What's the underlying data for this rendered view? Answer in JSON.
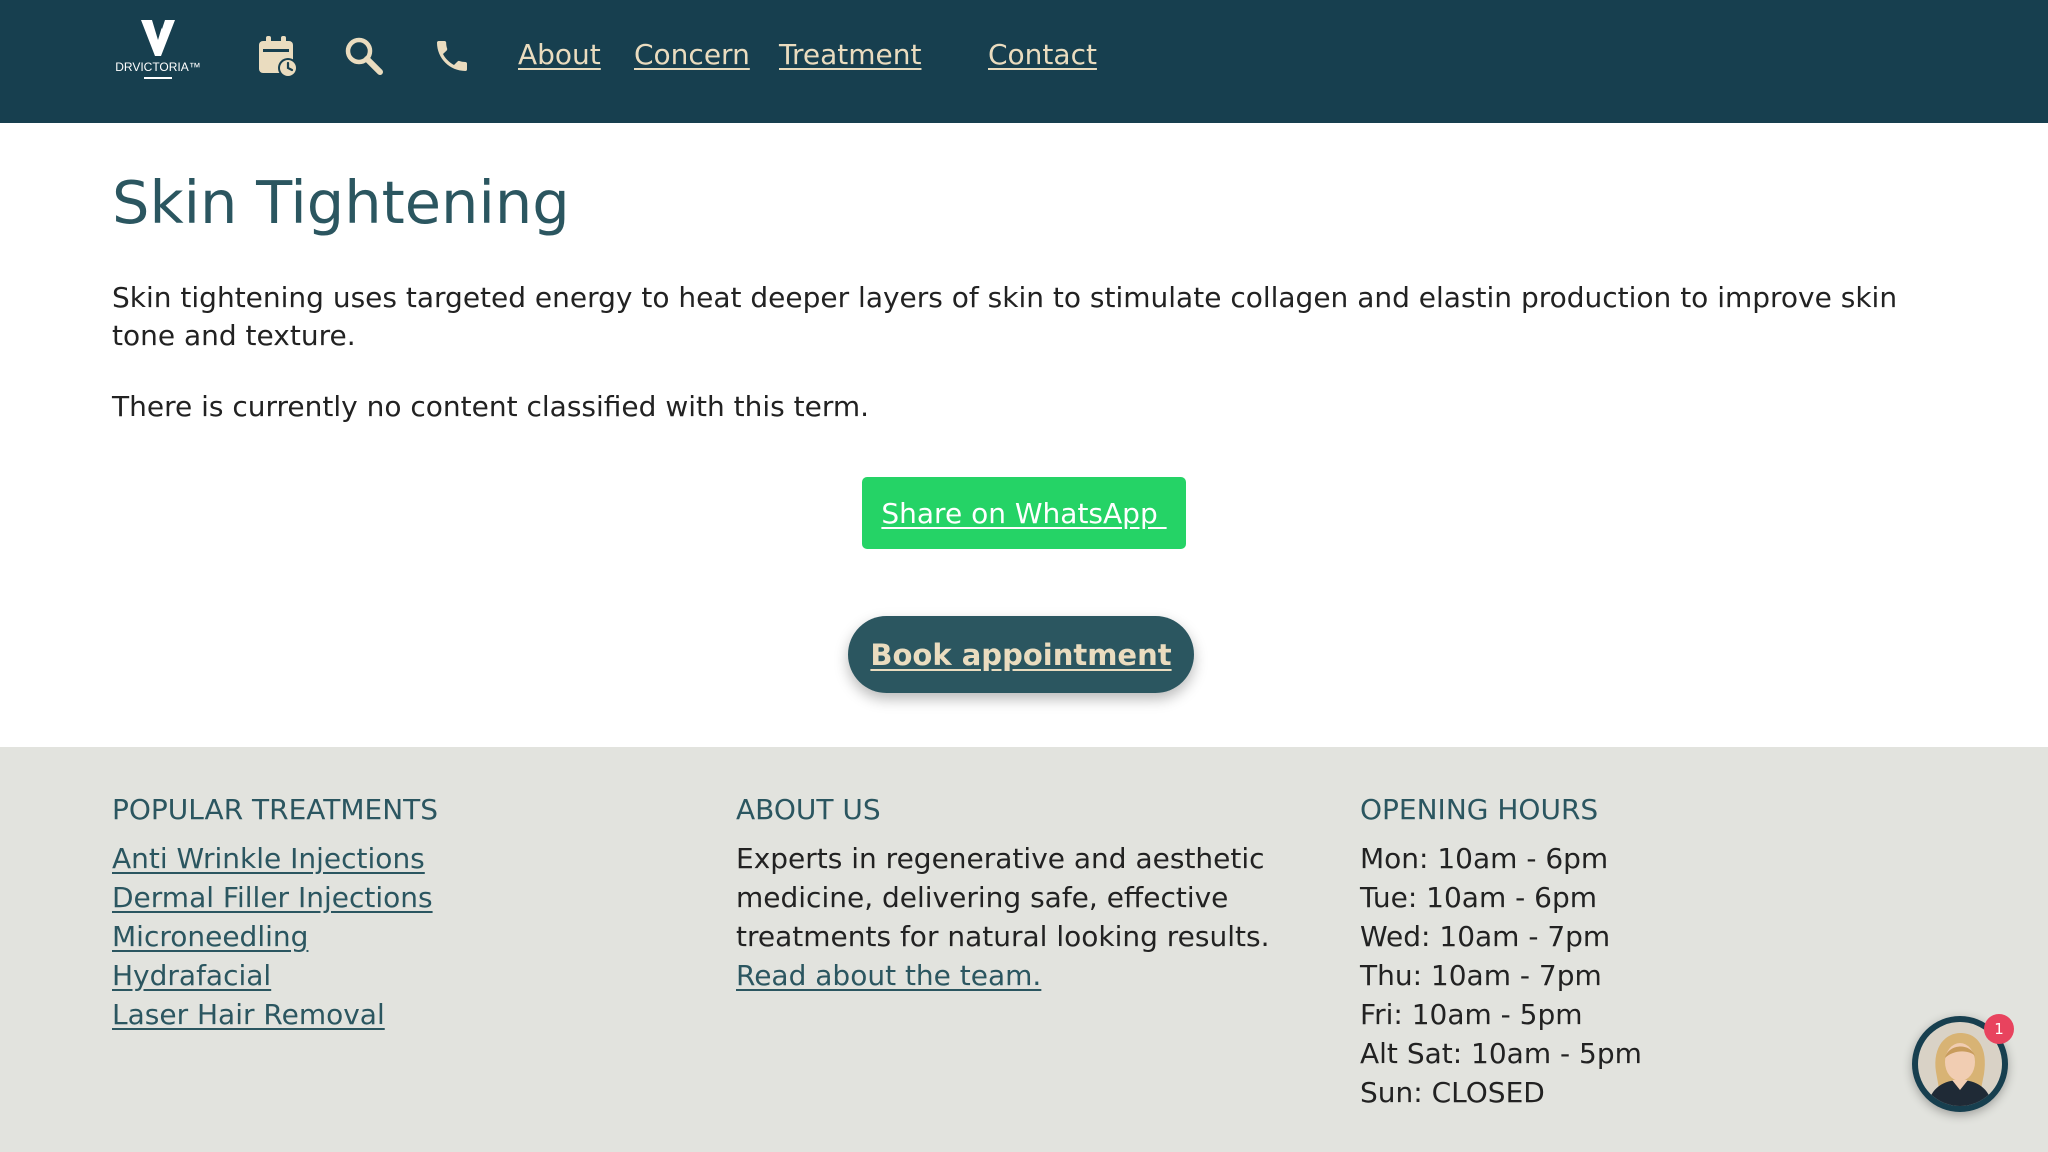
{
  "header": {
    "logo_text": "DRVICTORIA™",
    "logo_letter": "V",
    "icons": [
      "calendar-clock-icon",
      "search-icon",
      "phone-icon"
    ],
    "nav": [
      {
        "label": "About"
      },
      {
        "label": "Concern"
      },
      {
        "label": "Treatment"
      },
      {
        "label": "Contact"
      }
    ]
  },
  "main": {
    "title": "Skin Tightening",
    "intro": "Skin tightening uses targeted energy to heat deeper layers of skin to stimulate collagen and elastin production to improve skin tone and texture.",
    "no_content": "There is currently no content classified with this term.",
    "whatsapp_label": "Share on WhatsApp ",
    "book_label": "Book appointment"
  },
  "footer": {
    "popular": {
      "heading": "POPULAR TREATMENTS",
      "links": [
        "Anti Wrinkle Injections",
        "Dermal Filler Injections",
        "Microneedling",
        "Hydrafacial",
        "Laser Hair Removal"
      ]
    },
    "about": {
      "heading": "ABOUT US",
      "text": "Experts in regenerative and aesthetic medicine, delivering safe, effective treatments for natural looking results. ",
      "link": "Read about the team."
    },
    "hours": {
      "heading": "OPENING HOURS",
      "lines": [
        "Mon: 10am - 6pm",
        "Tue: 10am - 6pm",
        "Wed: 10am - 7pm",
        "Thu: 10am - 7pm",
        "Fri: 10am - 5pm",
        "Alt Sat: 10am - 5pm",
        "Sun: CLOSED"
      ]
    }
  },
  "chat": {
    "badge": "1"
  },
  "colors": {
    "header_bg": "#173f4f",
    "nav_text": "#eadcbf",
    "title": "#2b5660",
    "whatsapp": "#25d366",
    "book_bg": "#2b5660",
    "footer_bg": "#e2e3de",
    "badge": "#e8435e"
  }
}
